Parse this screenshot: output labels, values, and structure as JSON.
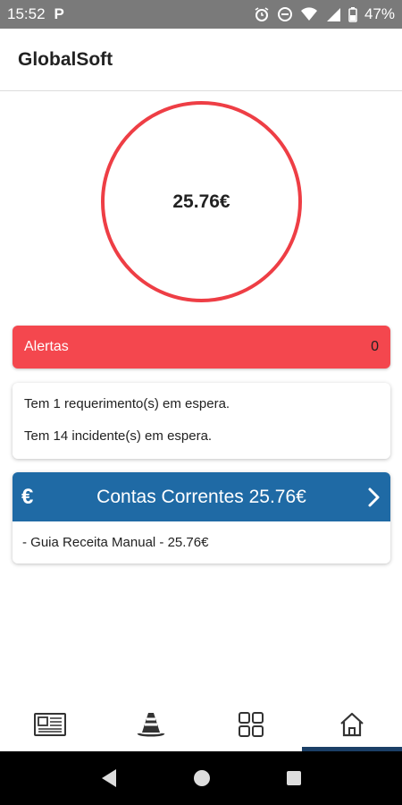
{
  "status_bar": {
    "time": "15:52",
    "app_icon": "P",
    "battery": "47%"
  },
  "header": {
    "title": "GlobalSoft"
  },
  "balance": {
    "amount": "25.76€",
    "ring_color": "#ee3e45"
  },
  "alerts": {
    "label": "Alertas",
    "count": "0",
    "color": "#f4474e"
  },
  "info": {
    "lines": [
      "Tem 1 requerimento(s) em espera.",
      "Tem 14 incidente(s) em espera."
    ]
  },
  "accounts": {
    "icon": "€",
    "title": "Contas Correntes 25.76€",
    "items": [
      "- Guia Receita Manual - 25.76€"
    ],
    "color": "#1f6aa5"
  },
  "bottom_nav": {
    "items": [
      {
        "icon": "newspaper-icon"
      },
      {
        "icon": "traffic-cone-icon"
      },
      {
        "icon": "grid-icon"
      },
      {
        "icon": "home-icon",
        "active": true
      }
    ]
  }
}
